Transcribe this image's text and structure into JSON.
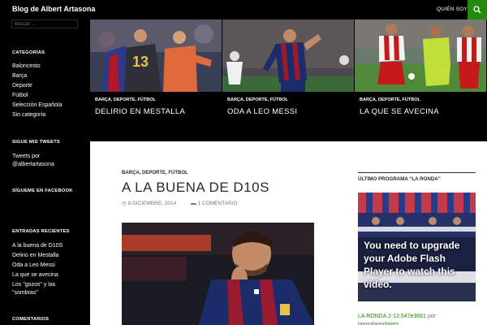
{
  "header": {
    "site_title": "Blog de Albert Artasona",
    "nav_item": "Quién soy",
    "search_icon": "search-icon",
    "accent": "#24890d"
  },
  "sidebar": {
    "search_placeholder": "Buscar …",
    "categories_title": "Categorías",
    "categories": [
      "Baloncesto",
      "Barça",
      "Deporte",
      "Fútbol",
      "Selección Española",
      "Sin categoría"
    ],
    "tweets_title": "Sigue mis tweets",
    "tweets_text_1": "Tweets por",
    "tweets_text_2": "@albertartasona",
    "facebook_title": "Sígueme en Facebook",
    "recent_title": "Entradas recientes",
    "recent": [
      "A la buena de D10S",
      "Delirio en Mestalla",
      "Oda a Leo Messi",
      "La que se avecina",
      "Los \"gozos\" y las",
      "\"sombras\""
    ],
    "comments_title": "Comentarios"
  },
  "featured": [
    {
      "category": "Barça, Deporte, Fútbol",
      "title": "Delirio en Mestalla"
    },
    {
      "category": "Barça, Deporte, Fútbol",
      "title": "Oda a Leo Messi"
    },
    {
      "category": "Barça, Deporte, Fútbol",
      "title": "La que se avecina"
    }
  ],
  "post": {
    "category": "Barça, Deporte, Fútbol",
    "title": "A la buena de D10S",
    "date": "8 diciembre, 2014",
    "comments": "1 comentario"
  },
  "right_sidebar": {
    "widget_title": "Último programa “La Ronda”",
    "flash_message": "You need to upgrade your Adobe Flash Player to watch this video.",
    "link_text": "LA RONDA 2-12.547e3661",
    "link_by": " por",
    "link_author": "larondaondaires"
  }
}
